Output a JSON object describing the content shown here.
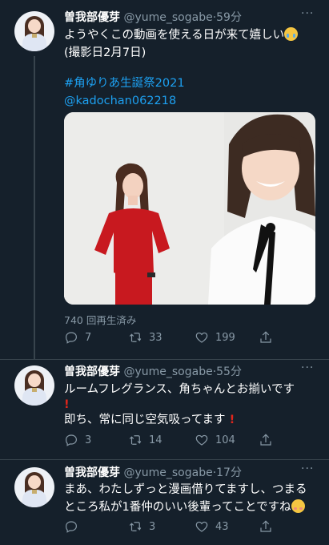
{
  "tweets": [
    {
      "name": "曽我部優芽",
      "handle": "@yume_sogabe",
      "time": "59分",
      "line1": "ようやくこの動画を使える日が来て嬉しい",
      "line2": "(撮影日2月7日)",
      "hashtag": "#角ゆりあ生誕祭2021",
      "mention": "@kadochan062218",
      "views": "740 回再生済み",
      "replies": "7",
      "retweets": "33",
      "likes": "199"
    },
    {
      "name": "曽我部優芽",
      "handle": "@yume_sogabe",
      "time": "55分",
      "line1": "ルームフレグランス、角ちゃんとお揃いです",
      "line2": "即ち、常に同じ空気吸ってます",
      "replies": "3",
      "retweets": "14",
      "likes": "104"
    },
    {
      "name": "曽我部優芽",
      "handle": "@yume_sogabe",
      "time": "17分",
      "line1": "まあ、わたしずっと漫画借りてますし、つまる",
      "line2": "ところ私が1番仲のいい後輩ってことですね",
      "replies": "",
      "retweets": "3",
      "likes": "43"
    }
  ],
  "icons": [
    "more-icon",
    "reply-icon",
    "retweet-icon",
    "like-icon",
    "share-icon",
    "sad-emoji",
    "exclamation-emoji",
    "smile-emoji"
  ],
  "colors": {
    "background": "#15202b",
    "link": "#1da1f2",
    "muted": "#8899a6",
    "divider": "#38444d"
  }
}
